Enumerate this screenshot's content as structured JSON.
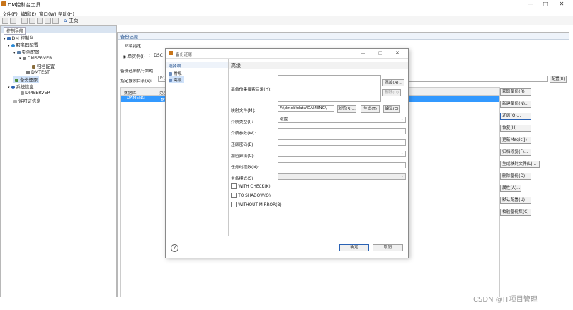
{
  "app": {
    "title": "DM控制台工具",
    "minimize": "—",
    "maximize": "□",
    "close": "✕"
  },
  "menu": [
    "文件(F)",
    "编辑(E)",
    "窗口(W)",
    "帮助(H)"
  ],
  "toolbar": {
    "home_label": "主页"
  },
  "left_panel": {
    "tab": "控制导航",
    "tree": [
      {
        "label": "DM 控制台",
        "depth": 0
      },
      {
        "label": "服务器配置",
        "depth": 1
      },
      {
        "label": "实例配置",
        "depth": 2
      },
      {
        "label": "DMSERVER",
        "depth": 3
      },
      {
        "label": "归档配置",
        "depth": 4
      },
      {
        "label": "DMTEST",
        "depth": 3
      },
      {
        "label": "备份还原",
        "depth": 1,
        "selected": true
      },
      {
        "label": "系统信息",
        "depth": 1
      },
      {
        "label": "DMSERVER",
        "depth": 2
      },
      {
        "label": "许可证信息",
        "depth": 1
      }
    ]
  },
  "main": {
    "section_title": "备份还原",
    "env_group": "环境指定",
    "radio_single": "单实例(I)",
    "radio_dsc": "DSC",
    "backup_exec_label": "备份还原执行策略:",
    "path_label": "指定搜索目录(S):",
    "path_value": "F:\\",
    "config_button": "配置(E)",
    "table_header": [
      "数据库",
      "范围"
    ],
    "table_row": [
      "DAMENG",
      "数据"
    ]
  },
  "side_buttons": [
    "获取备份(R)",
    "新建备份(N)...",
    "还原(O)...",
    "恢复(H)",
    "更新Magic(J)",
    "归档修复(F)...",
    "生成映射文件(L)...",
    "删除备份(D)",
    "属性(A)...",
    "默认配置(U)",
    "校验备份集(C)"
  ],
  "dialog": {
    "title": "备份还原",
    "nav_header": "选择项",
    "nav_items": [
      "常规",
      "高级"
    ],
    "panel_title": "高级",
    "fields": {
      "backup_dirs_label": "基备份集搜索目录(H):",
      "add_button": "添加(A)...",
      "delete_button": "删除(D)",
      "map_file_label": "映射文件(M):",
      "map_file_value": "F:\\dmdb\\data\\DAMENG\\",
      "browse_button": "浏览(R)...",
      "generate_button": "生成(T)",
      "edit_button": "编辑(E)",
      "media_type_label": "介质类型(I):",
      "media_type_value": "磁盘",
      "media_param_label": "介质参数(W):",
      "restore_password_label": "还原密码(E):",
      "encrypt_label": "加密算法(C):",
      "task_threads_label": "任务线程数(N):",
      "master_mode_label": "主备模式(S):"
    },
    "checkboxes": [
      "WITH CHECK(K)",
      "TO SHADOW(O)",
      "WITHOUT MIRROR(B)"
    ],
    "help": "?",
    "ok_button": "确定",
    "cancel_button": "取消"
  },
  "watermark": "CSDN @IT项目管理",
  "colors": {
    "selection": "#3399ff",
    "section_text": "#1f4e8c",
    "tab_bg": "#d9e4f1"
  }
}
